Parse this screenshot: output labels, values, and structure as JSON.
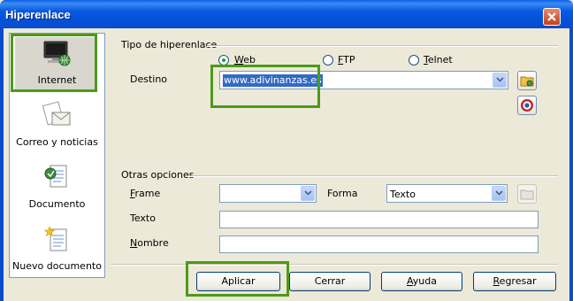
{
  "window": {
    "title": "Hiperenlace",
    "close_icon": "close-icon"
  },
  "sidebar": {
    "items": [
      {
        "label": "Internet",
        "icon": "internet-icon",
        "selected": true
      },
      {
        "label": "Correo y noticias",
        "icon": "mail-icon",
        "selected": false
      },
      {
        "label": "Documento",
        "icon": "document-icon",
        "selected": false
      },
      {
        "label": "Nuevo documento",
        "icon": "new-document-icon",
        "selected": false
      }
    ]
  },
  "hyperlink_type": {
    "title": "Tipo de hiperenlace",
    "options": [
      {
        "label_access": "W",
        "label_rest": "eb",
        "selected": true
      },
      {
        "label_access": "F",
        "label_rest": "TP",
        "selected": false
      },
      {
        "label_access": "T",
        "label_rest": "elnet",
        "selected": false
      }
    ],
    "target_label": "Destino",
    "target_value": "www.adivinanzas.es"
  },
  "other_options": {
    "title": "Otras opciones",
    "frame_label_access": "F",
    "frame_label_rest": "rame",
    "frame_value": "",
    "form_label": "Forma",
    "form_value": "Texto",
    "text_label": "Texto",
    "text_value": "",
    "name_label_access": "N",
    "name_label_rest": "ombre",
    "name_value": ""
  },
  "buttons": {
    "apply": "Aplicar",
    "close": "Cerrar",
    "help_access": "A",
    "help_rest": "yuda",
    "back_access": "R",
    "back_rest": "egresar"
  },
  "colors": {
    "titlebar": "#0a5ee0",
    "highlight": "#4d9a19",
    "selection": "#316ac5"
  }
}
